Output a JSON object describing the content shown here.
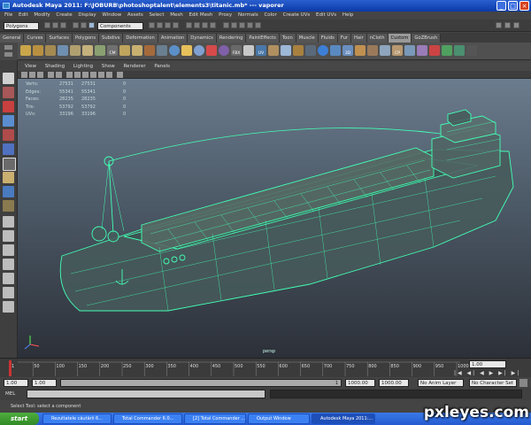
{
  "window": {
    "title": "Autodesk Maya 2011: F:\\JOBURB\\photoshoptalent\\elements3\\titanic.mb*  ---  vaporer"
  },
  "menubar": {
    "items": [
      "File",
      "Edit",
      "Modify",
      "Create",
      "Display",
      "Window",
      "Assets",
      "Select",
      "Mesh",
      "Edit Mesh",
      "Proxy",
      "Normals",
      "Color",
      "Create UVs",
      "Edit UVs",
      "Help"
    ]
  },
  "statusline": {
    "menu_set": "Polygons",
    "selection_mode": "Components"
  },
  "shelf": {
    "tabs": [
      "General",
      "Curves",
      "Surfaces",
      "Polygons",
      "Subdivs",
      "Deformation",
      "Animation",
      "Dynamics",
      "Rendering",
      "PaintEffects",
      "Toon",
      "Muscle",
      "Fluids",
      "Fur",
      "Hair",
      "nCloth",
      "Custom",
      "GoZBrush"
    ],
    "active_tab": "Custom",
    "icon_labels": [
      "CM",
      "FBX",
      "UV",
      "3D",
      "CP"
    ]
  },
  "panel": {
    "menus": [
      "View",
      "Shading",
      "Lighting",
      "Show",
      "Renderer",
      "Panels"
    ]
  },
  "hud": {
    "rows": [
      {
        "label": "Verts:",
        "v1": "27531",
        "v2": "27531",
        "v3": "0"
      },
      {
        "label": "Edges:",
        "v1": "55341",
        "v2": "55341",
        "v3": "0"
      },
      {
        "label": "Faces:",
        "v1": "28235",
        "v2": "28235",
        "v3": "0"
      },
      {
        "label": "Tris:",
        "v1": "53792",
        "v2": "53792",
        "v3": "0"
      },
      {
        "label": "UVs:",
        "v1": "33196",
        "v2": "33196",
        "v3": "0"
      }
    ]
  },
  "viewport": {
    "camera": "persp"
  },
  "timeline": {
    "ticks": [
      "1",
      "50",
      "100",
      "150",
      "200",
      "250",
      "300",
      "350",
      "400",
      "450",
      "500",
      "550",
      "600",
      "650",
      "700",
      "750",
      "800",
      "850",
      "900",
      "950",
      "1000"
    ],
    "current_frame": "1.00"
  },
  "range": {
    "start": "1.00",
    "playback_start": "1.00",
    "playback_end": "1000.00",
    "end": "1000.00",
    "frame_value": "1",
    "anim_layer": "No Anim Layer",
    "character_set": "No Character Set"
  },
  "mel": {
    "label": "MEL"
  },
  "helpline": {
    "text": "Select Tool: select a component"
  },
  "taskbar": {
    "start": "start",
    "tasks": [
      "Rezultatele căutării 6...",
      "Total Commander 6.0...",
      "[2] Total Commander ...",
      "Output Window",
      "Autodesk Maya 2011:..."
    ]
  },
  "watermark": {
    "text": "pxleyes.com"
  },
  "colors": {
    "wire": "#42ffb4",
    "accent": "#2a5fcf",
    "taskbar": "#245ad0"
  }
}
